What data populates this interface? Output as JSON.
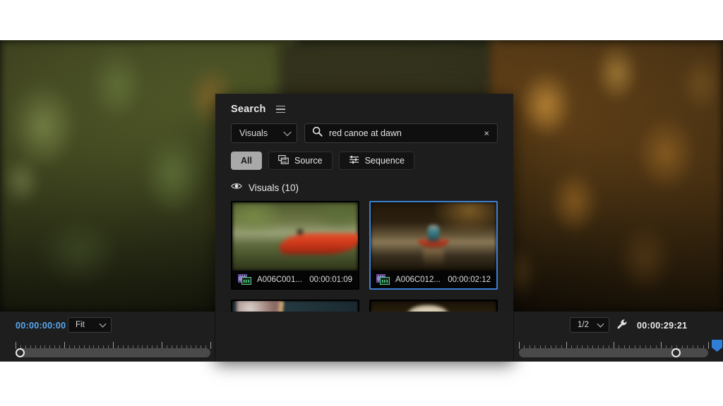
{
  "app": {
    "background_scene": "blurred autumn foliage video frame"
  },
  "search_panel": {
    "title": "Search",
    "menu_icon": "hamburger-menu-icon",
    "category_dropdown": {
      "value": "Visuals",
      "caret_icon": "chevron-down-icon"
    },
    "search_field": {
      "value": "red canoe at dawn",
      "placeholder": "Search",
      "search_icon": "search-icon",
      "clear_icon": "close-icon",
      "clear_glyph": "×"
    },
    "filters": [
      {
        "label": "All",
        "icon": null,
        "active": true
      },
      {
        "label": "Source",
        "icon": "source-media-icon",
        "active": false
      },
      {
        "label": "Sequence",
        "icon": "sequence-tracks-icon",
        "active": false
      }
    ],
    "results": {
      "visibility_icon": "eye-icon",
      "label": "Visuals (10)",
      "items": [
        {
          "name": "A006C001...",
          "duration": "00:00:01:09",
          "selected": false,
          "badge_icons": [
            "filmstrip-badge-icon",
            "clip-badge-icon"
          ],
          "thumb": "red canoe bow on water"
        },
        {
          "name": "A006C012...",
          "duration": "00:00:02:12",
          "selected": true,
          "badge_icons": [
            "filmstrip-badge-icon",
            "clip-badge-icon"
          ],
          "thumb": "paddler in canoe at dawn"
        },
        {
          "name": "",
          "duration": "",
          "selected": false,
          "badge_icons": [],
          "thumb": "person paddling red canoe"
        },
        {
          "name": "",
          "duration": "",
          "selected": false,
          "badge_icons": [],
          "thumb": "person with hat and camera in canoe"
        }
      ]
    }
  },
  "timeline": {
    "left": {
      "timecode": "00:00:00:00",
      "zoom_dropdown": {
        "value": "Fit",
        "caret_icon": "chevron-down-icon"
      },
      "playhead_position_pct": 2
    },
    "right": {
      "resolution_dropdown": {
        "value": "1/2",
        "caret_icon": "chevron-down-icon"
      },
      "settings_icon": "wrench-icon",
      "timecode": "00:00:29:21",
      "playhead_position_pct": 83,
      "marker_icon": "marker-pin-icon"
    }
  },
  "colors": {
    "accent_blue": "#3b7fd4",
    "timecode_blue": "#5aa9f0",
    "panel_bg": "#1d1d1d",
    "timeline_bg": "#1e1e1e",
    "chip_active_bg": "#a9a9a9",
    "marker_blue": "#2f7fd8"
  }
}
